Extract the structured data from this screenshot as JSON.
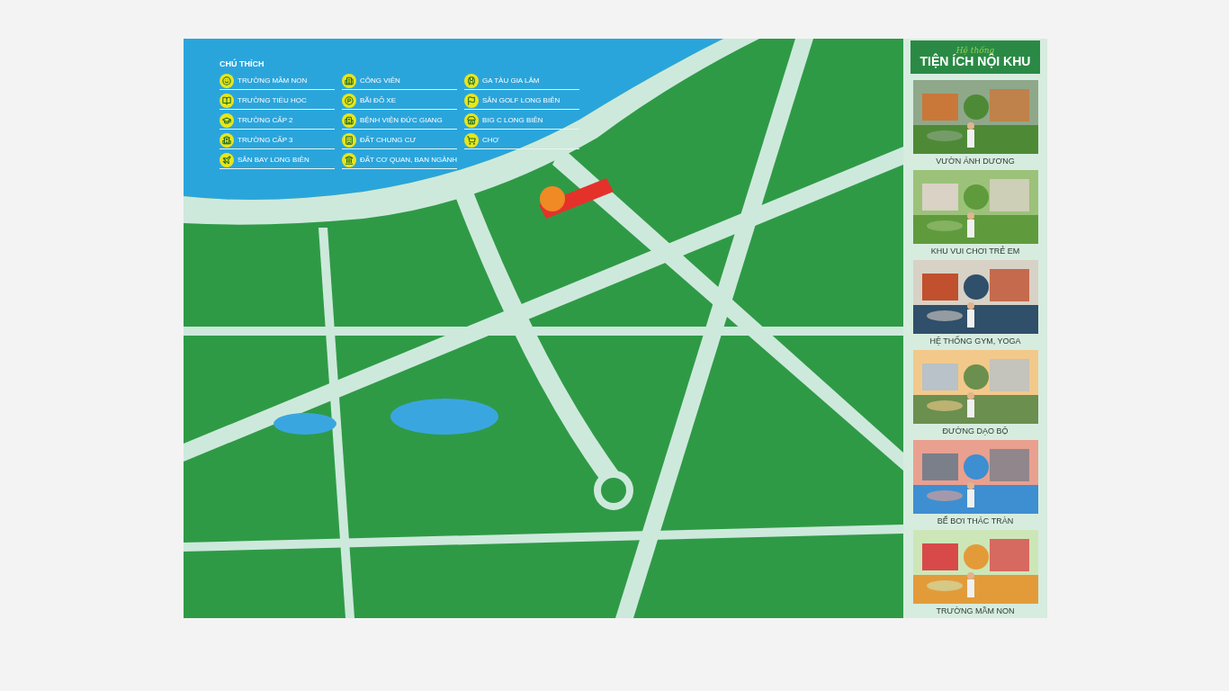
{
  "legend": {
    "title": "CHÚ THÍCH",
    "columns": [
      [
        "TRƯỜNG MẦM NON",
        "TRƯỜNG TIỂU HỌC",
        "TRƯỜNG CẤP 2",
        "TRƯỜNG CẤP 3",
        "SÂN BAY LONG BIÊN"
      ],
      [
        "CÔNG VIÊN",
        "BÃI ĐỖ XE",
        "BỆNH VIỆN ĐỨC GIANG",
        "ĐẤT CHUNG CƯ",
        "ĐẤT CƠ QUAN, BAN NGÀNH"
      ],
      [
        "GA TÀU GIA LÂM",
        "SÂN GOLF LONG BIÊN",
        "BIG C LONG BIÊN",
        "CHỢ"
      ]
    ]
  },
  "panel": {
    "subtitle": "Hệ thống",
    "title": "TIỆN ÍCH NỘI KHU",
    "items": [
      {
        "caption": "VƯỜN ÁNH DƯƠNG"
      },
      {
        "caption": "KHU VUI CHƠI TRẺ EM"
      },
      {
        "caption": "HỆ THỐNG GYM, YOGA"
      },
      {
        "caption": "ĐƯỜNG DẠO BỘ"
      },
      {
        "caption": "BỂ BƠI THÁC TRÀN"
      },
      {
        "caption": "TRƯỜNG MẦM NON"
      }
    ]
  }
}
